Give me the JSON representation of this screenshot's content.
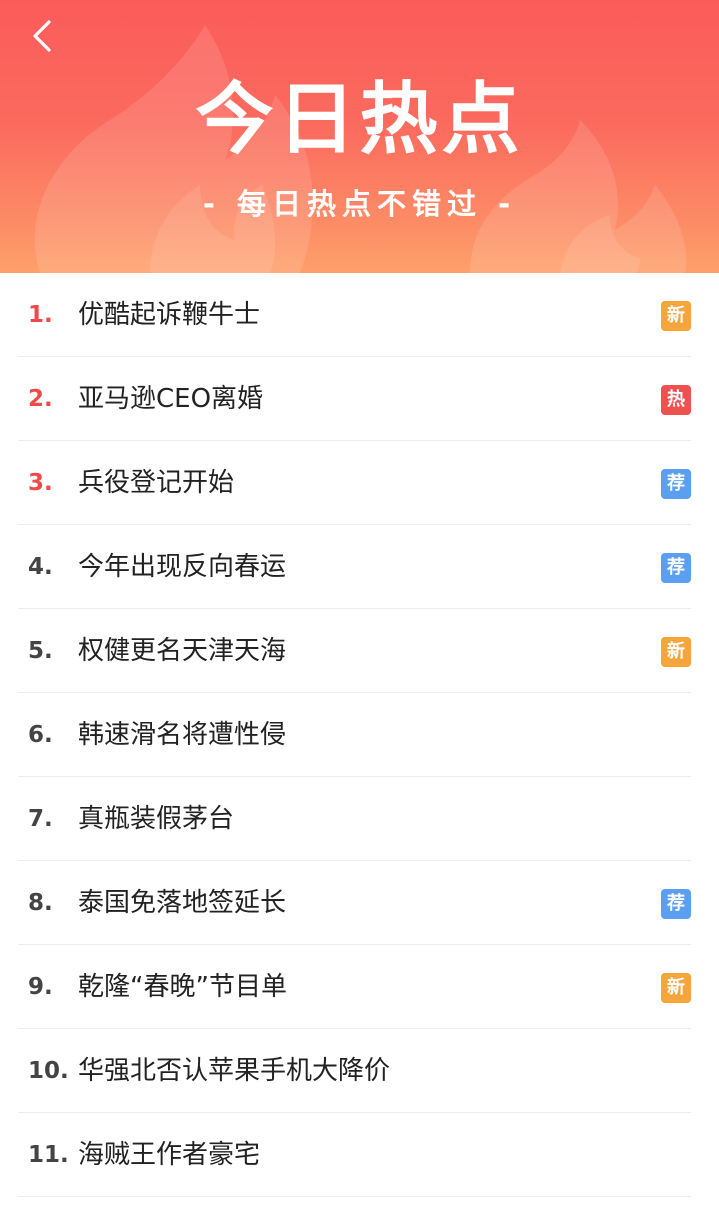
{
  "header": {
    "back_icon": "chevron-left-icon",
    "title": "今日热点",
    "subtitle": "- 每日热点不错过 -"
  },
  "colors": {
    "header_top": "#fb5c5a",
    "header_bottom": "#fea06a",
    "rank_hot": "#f0494a",
    "badge_new": "#f6a53d",
    "badge_hot": "#ef5050",
    "badge_rec": "#5b9ff0"
  },
  "items": [
    {
      "rank": "1.",
      "title": "优酷起诉鞭牛士",
      "badge": "新",
      "badge_type": "new"
    },
    {
      "rank": "2.",
      "title": "亚马逊CEO离婚",
      "badge": "热",
      "badge_type": "hot"
    },
    {
      "rank": "3.",
      "title": "兵役登记开始",
      "badge": "荐",
      "badge_type": "rec"
    },
    {
      "rank": "4.",
      "title": "今年出现反向春运",
      "badge": "荐",
      "badge_type": "rec"
    },
    {
      "rank": "5.",
      "title": "权健更名天津天海",
      "badge": "新",
      "badge_type": "new"
    },
    {
      "rank": "6.",
      "title": "韩速滑名将遭性侵",
      "badge": "",
      "badge_type": ""
    },
    {
      "rank": "7.",
      "title": "真瓶装假茅台",
      "badge": "",
      "badge_type": ""
    },
    {
      "rank": "8.",
      "title": "泰国免落地签延长",
      "badge": "荐",
      "badge_type": "rec"
    },
    {
      "rank": "9.",
      "title": "乾隆“春晚”节目单",
      "badge": "新",
      "badge_type": "new"
    },
    {
      "rank": "10.",
      "title": "华强北否认苹果手机大降价",
      "badge": "",
      "badge_type": ""
    },
    {
      "rank": "11.",
      "title": "海贼王作者豪宅",
      "badge": "",
      "badge_type": ""
    }
  ]
}
